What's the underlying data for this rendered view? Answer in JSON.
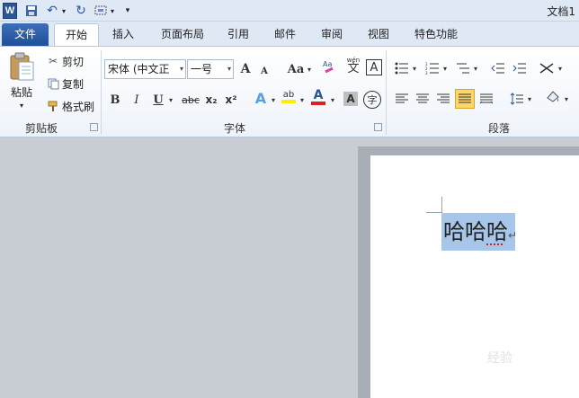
{
  "titlebar": {
    "logo_letter": "W",
    "doc_title": "文档1"
  },
  "tabs": [
    {
      "label": "文件"
    },
    {
      "label": "开始"
    },
    {
      "label": "插入"
    },
    {
      "label": "页面布局"
    },
    {
      "label": "引用"
    },
    {
      "label": "邮件"
    },
    {
      "label": "审阅"
    },
    {
      "label": "视图"
    },
    {
      "label": "特色功能"
    }
  ],
  "clipboard": {
    "paste": "粘贴",
    "cut": "剪切",
    "copy": "复制",
    "format_painter": "格式刷",
    "group_label": "剪贴板"
  },
  "font": {
    "font_name": "宋体 (中文正",
    "font_size": "一号",
    "grow": "A",
    "shrink": "A",
    "change_case": "Aa",
    "bold": "B",
    "italic": "I",
    "underline": "U",
    "strike": "abc",
    "subscript": "x₂",
    "superscript": "x²",
    "text_effect": "A",
    "highlight": "ab",
    "font_color": "A",
    "char_shading": "A",
    "enclose": "字",
    "phonetic": "wén",
    "border_char": "A",
    "group_label": "字体"
  },
  "paragraph": {
    "group_label": "段落"
  },
  "document": {
    "text": "哈哈哈",
    "para_mark": "↵"
  },
  "watermark": "经验"
}
